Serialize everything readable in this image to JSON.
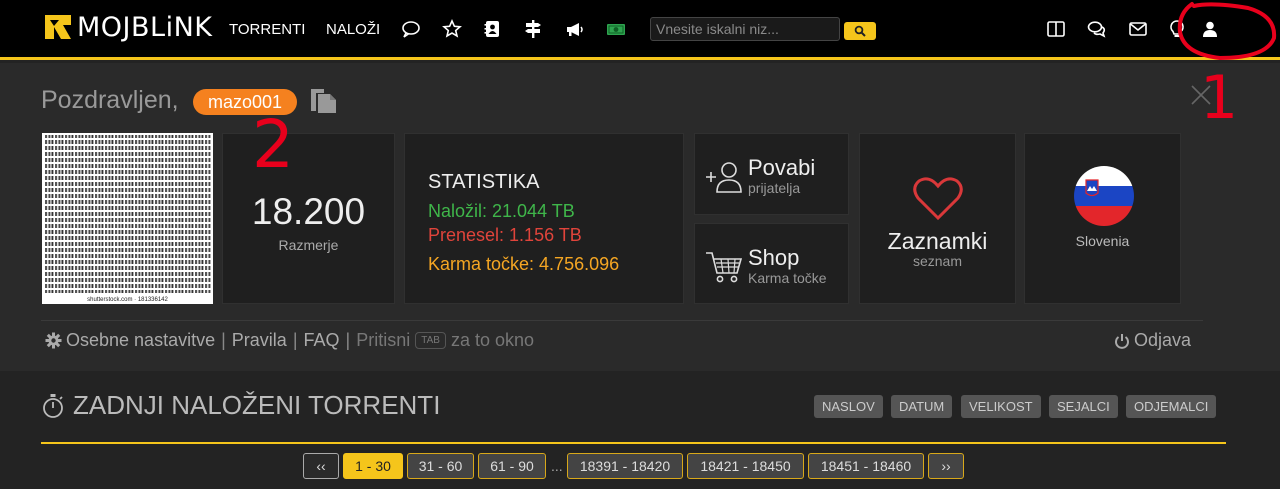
{
  "brand": {
    "name": "MOJBLiNK"
  },
  "nav": {
    "torrents": "TORRENTI",
    "upload": "NALOŽI",
    "search_placeholder": "Vnesite iskalni niz..."
  },
  "icons": [
    "chat-bubble-icon",
    "star-icon",
    "contact-book-icon",
    "signpost-icon",
    "megaphone-icon",
    "money-icon",
    "search-icon",
    "columns-icon",
    "comments-icon",
    "envelope-icon",
    "lightbulb-icon",
    "user-icon"
  ],
  "annotations": {
    "one": "1",
    "two": "2"
  },
  "panel": {
    "greeting": "Pozdravljen,",
    "username": "mazo001",
    "avatar_caption": "shutterstock.com · 181336142",
    "ratio": {
      "value": "18.200",
      "label": "Razmerje"
    },
    "stats": {
      "title": "STATISTIKA",
      "uploaded": "Naložil: 21.044 TB",
      "downloaded": "Prenesel: 1.156 TB",
      "karma": "Karma točke: 4.756.096"
    },
    "invite": {
      "title": "Povabi",
      "subtitle": "prijatelja"
    },
    "shop": {
      "title": "Shop",
      "subtitle": "Karma točke"
    },
    "bookmarks": {
      "title": "Zaznamki",
      "subtitle": "seznam"
    },
    "country": "Slovenia",
    "colors": {
      "uploaded": "#3fb64a",
      "downloaded": "#e0443b",
      "karma": "#f5a623",
      "accent": "#f5c51b",
      "username_pill": "#f5811f"
    }
  },
  "footer": {
    "settings": "Osebne nastavitve",
    "rules": "Pravila",
    "faq": "FAQ",
    "press": "Pritisni",
    "tab_key": "TAB",
    "hint": "za to okno",
    "logout": "Odjava"
  },
  "latest": {
    "title": "ZADNJI NALOŽENI TORRENTI",
    "sort_buttons": [
      "NASLOV",
      "DATUM",
      "VELIKOST",
      "SEJALCI",
      "ODJEMALCI"
    ]
  },
  "pagination": {
    "prev": "‹‹",
    "pages": [
      "1 - 30",
      "31 - 60",
      "61 - 90"
    ],
    "ellipsis": "...",
    "last_pages": [
      "18391 - 18420",
      "18421 - 18450",
      "18451 - 18460"
    ],
    "next": "››",
    "active_page": "1 - 30"
  }
}
